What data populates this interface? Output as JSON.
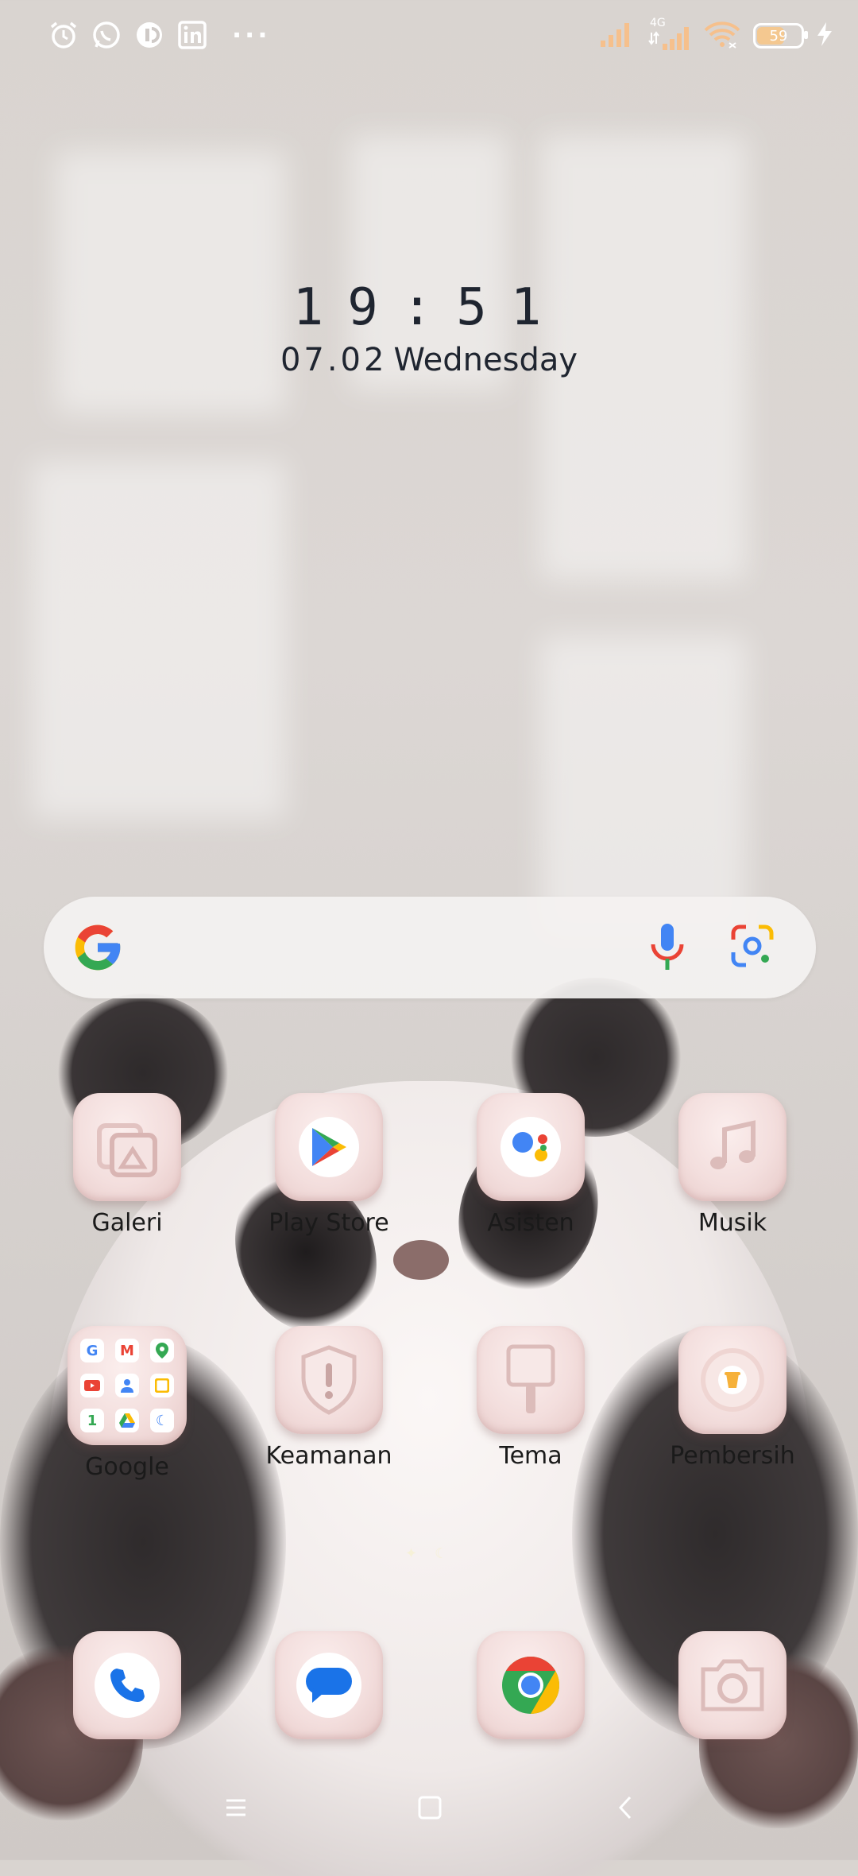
{
  "statusbar": {
    "left_icons": [
      "alarm-icon",
      "whatsapp-icon",
      "messenger-icon",
      "linkedin-icon"
    ],
    "more": "···",
    "network_type": "4G",
    "battery": "59"
  },
  "clock": {
    "time": "19:51",
    "date": "07.02",
    "weekday": "Wednesday"
  },
  "search": {
    "placeholder": ""
  },
  "apps": [
    {
      "label": "Galeri"
    },
    {
      "label": "Play Store"
    },
    {
      "label": "Asisten"
    },
    {
      "label": "Musik"
    },
    {
      "label": "Google"
    },
    {
      "label": "Keamanan"
    },
    {
      "label": "Tema"
    },
    {
      "label": "Pembersih"
    }
  ],
  "dock": [
    "phone-icon",
    "messages-icon",
    "chrome-icon",
    "camera-icon"
  ],
  "colors": {
    "icon_bg": "#f3dedd",
    "clock_text": "#1f2530",
    "google_blue": "#4285F4",
    "google_red": "#EA4335",
    "google_yellow": "#FBBC05",
    "google_green": "#34A853"
  }
}
